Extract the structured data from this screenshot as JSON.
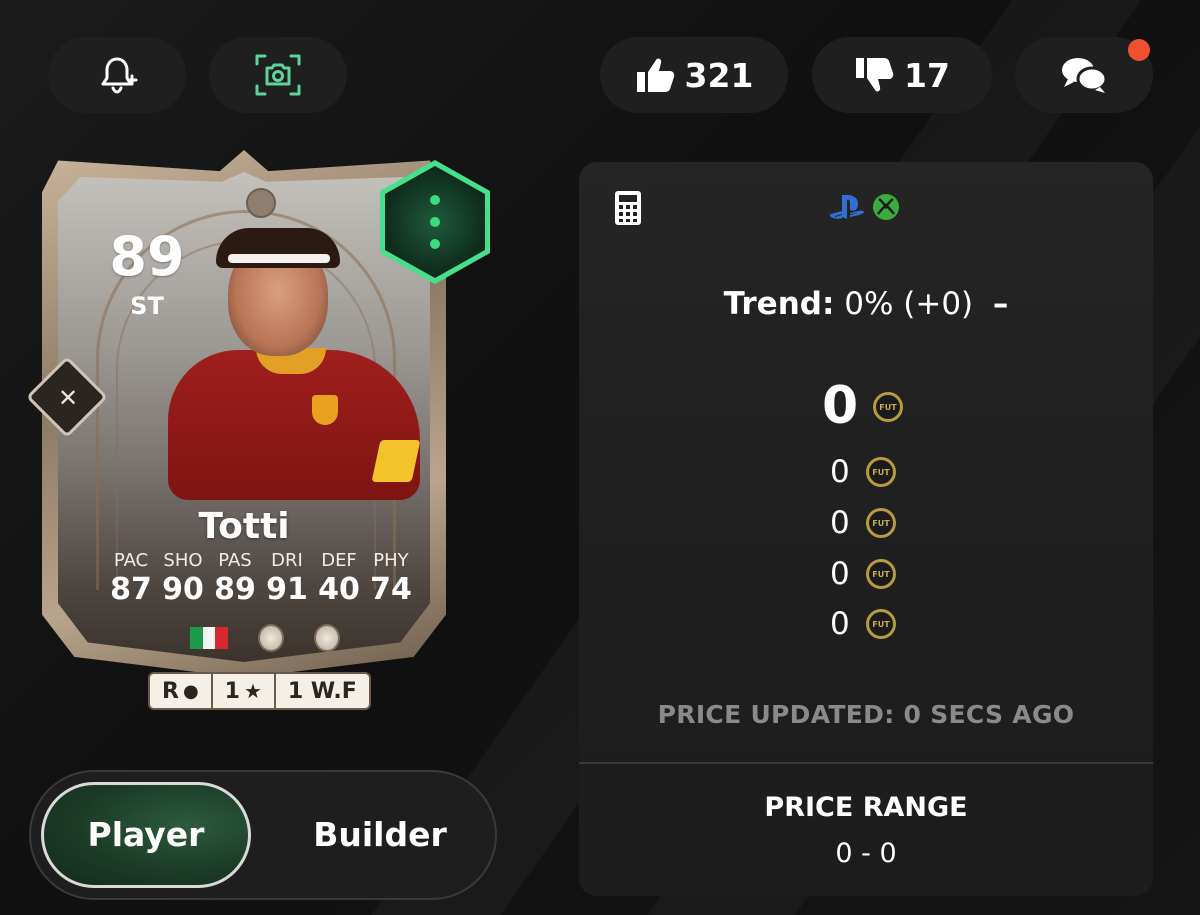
{
  "top_bar": {
    "likes_count": "321",
    "dislikes_count": "17",
    "has_notification": true
  },
  "card": {
    "rating": "89",
    "position": "ST",
    "name": "Totti",
    "stat_labels": [
      "PAC",
      "SHO",
      "PAS",
      "DRI",
      "DEF",
      "PHY"
    ],
    "stat_values": [
      "87",
      "90",
      "89",
      "91",
      "40",
      "74"
    ],
    "chips": {
      "foot": "R",
      "skill_moves": "1",
      "weak_foot": "1 W.F"
    },
    "accent_color": "#46e08a"
  },
  "toggle": {
    "player_label": "Player",
    "builder_label": "Builder",
    "active": "Player"
  },
  "price_panel": {
    "trend_label": "Trend:",
    "trend_value": "0% (+0)",
    "trend_arrow": "–",
    "main_price": "0",
    "other_prices": [
      "0",
      "0",
      "0",
      "0"
    ],
    "coin_label": "FUT",
    "updated_text": "PRICE UPDATED: 0 SECS AGO",
    "range_title": "PRICE RANGE",
    "range_value": "0 - 0"
  },
  "colors": {
    "background": "#121212",
    "pill": "#1f1f1f",
    "accent_green": "#46e08a",
    "notification": "#f0512c",
    "coin_gold": "#b79b3f"
  }
}
